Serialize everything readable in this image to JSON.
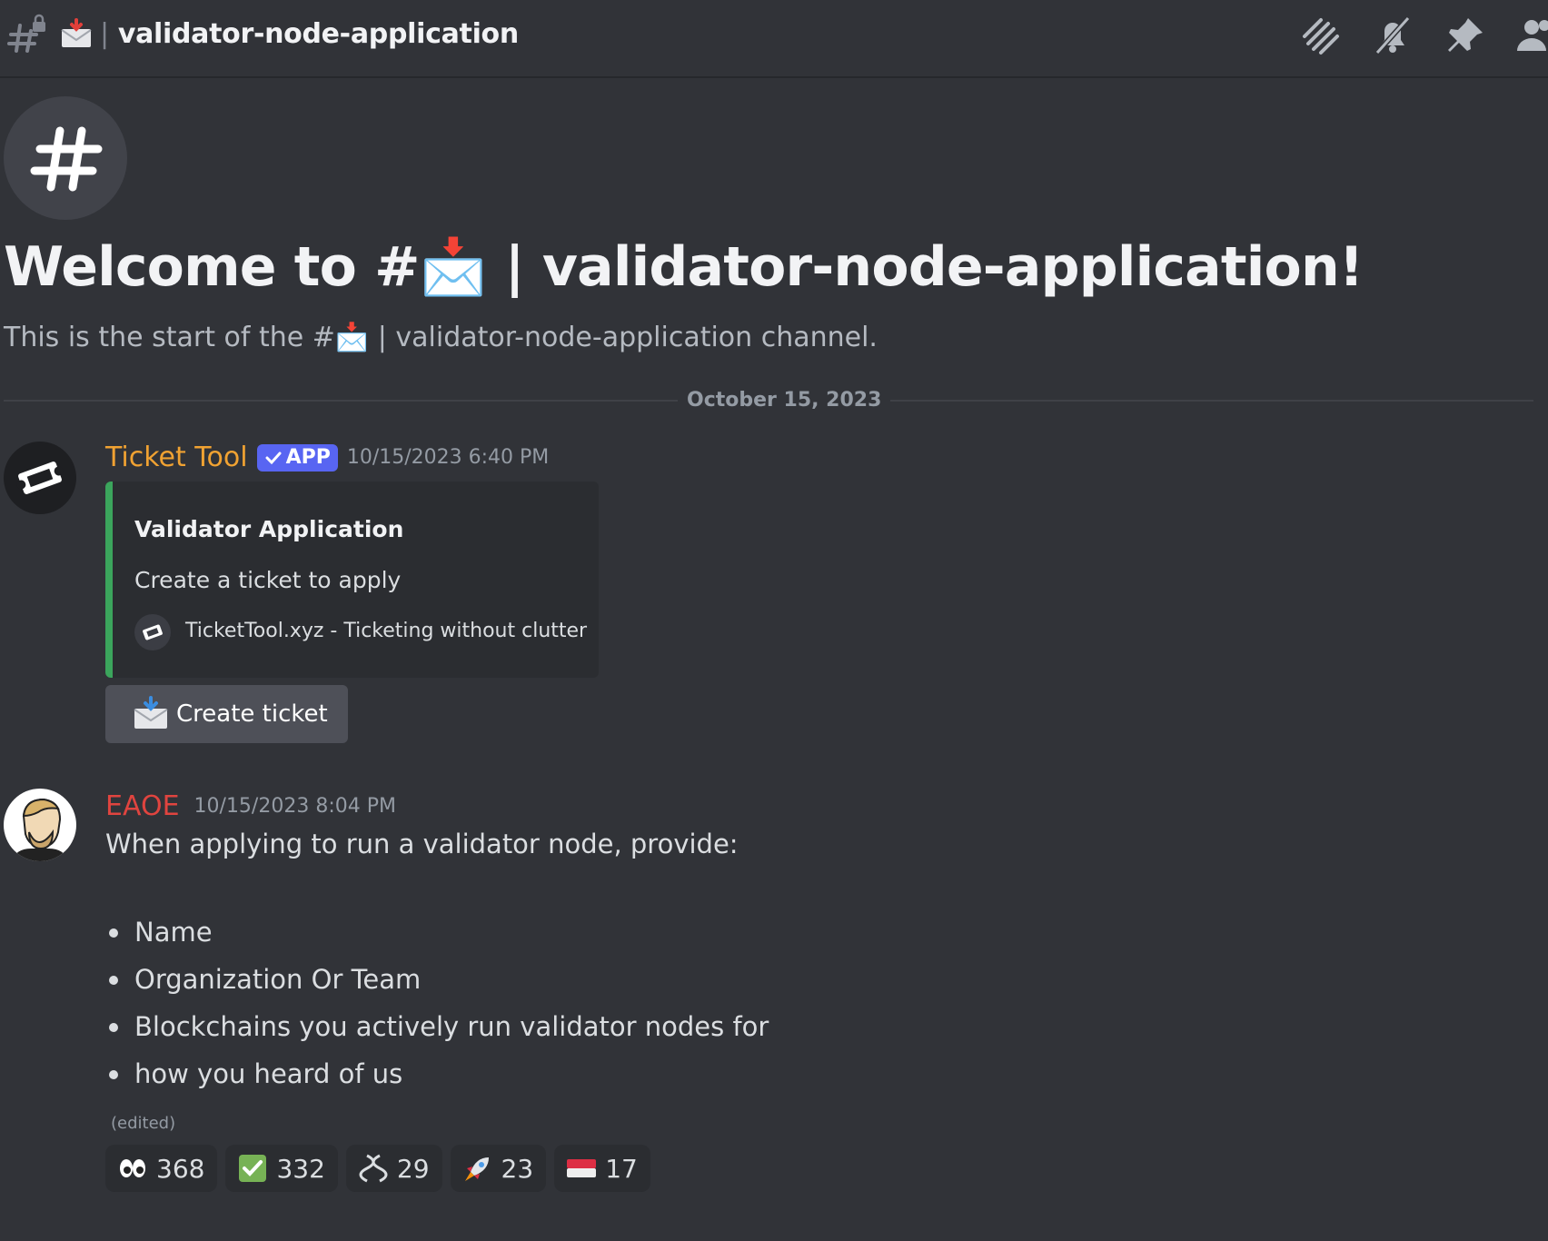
{
  "header": {
    "channel_title": "validator-node-application",
    "icons": [
      "hashtag-lock-icon",
      "envelope-icon",
      "threads-icon",
      "mute-bell-icon",
      "pin-icon",
      "members-icon"
    ]
  },
  "welcome": {
    "title": "Welcome to #📩 | validator-node-application!",
    "subtitle": "This is the start of the #📩 | validator-node-application channel."
  },
  "date_divider": "October 15, 2023",
  "messages": [
    {
      "author": "Ticket Tool",
      "author_color": "#f0a232",
      "badge": "APP",
      "timestamp": "10/15/2023 6:40 PM",
      "embed": {
        "accent": "#3ba55c",
        "title": "Validator Application",
        "description": "Create a ticket to apply",
        "footer": "TicketTool.xyz - Ticketing without clutter"
      },
      "button": "Create ticket"
    },
    {
      "author": "EAOE",
      "author_color": "#e0443f",
      "timestamp": "10/15/2023 8:04 PM",
      "body": "When applying to run a validator node, provide:",
      "bullets": [
        "Name",
        "Organization Or Team",
        "Blockchains you actively run validator nodes for",
        "how you heard of us"
      ],
      "edited": "(edited)",
      "reactions": [
        {
          "emoji": "eyes-icon",
          "count": "368"
        },
        {
          "emoji": "check-mark-icon",
          "count": "332"
        },
        {
          "emoji": "dna-icon",
          "count": "29"
        },
        {
          "emoji": "rocket-icon",
          "count": "23"
        },
        {
          "emoji": "flag-icon",
          "count": "17"
        }
      ]
    }
  ]
}
